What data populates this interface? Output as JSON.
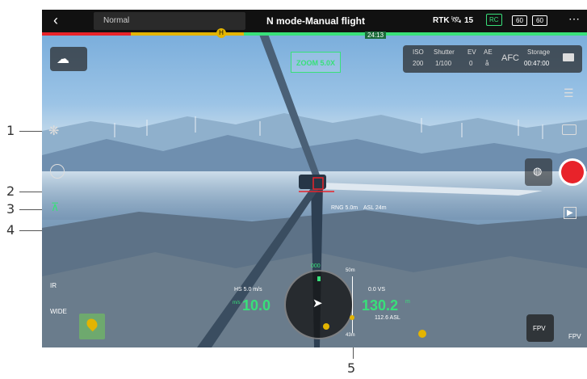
{
  "callouts": [
    "1",
    "2",
    "3",
    "4",
    "5"
  ],
  "topbar": {
    "back_icon": "chevron-left-icon",
    "mode_text": "Normal",
    "title": "N mode-Manual flight",
    "rtk_label": "RTK",
    "satellite_count": "15",
    "rc_badge": "RC",
    "battery_1": "60",
    "battery_2": "60",
    "more_icon": "more-horizontal-icon",
    "timer": "24:13"
  },
  "camera_params": {
    "iso_label": "ISO",
    "iso_value": "200",
    "shutter_label": "Shutter",
    "shutter_value": "1/100",
    "ev_label": "EV",
    "ev_value": "0",
    "ae_label": "AE",
    "ae_value": "å",
    "focus_mode": "AFC",
    "storage_label": "Storage",
    "storage_value": "00:47:00"
  },
  "zoom_indicator": "ZOOM 5.0X",
  "side_labels": {
    "ir": "IR",
    "wide": "WIDE"
  },
  "telemetry": {
    "distance_label": "RNG 5.0m",
    "asl_label": "ASL 24m",
    "hs_label": "HS 5.0 m/s",
    "vs_label": "0.0 VS",
    "speed_value": "10.0",
    "speed_unit": "m/s",
    "altitude_value": "130.2",
    "altitude_unit": "m",
    "asl_reading": "112.6 ASL",
    "compass_heading": "000",
    "altitude_scale_top": "50m",
    "altitude_scale_bottom": "43m"
  },
  "buttons": {
    "fpv_label": "FPV",
    "fpv_bottom_label": "FPV"
  },
  "colors": {
    "accent_green": "#38e07a",
    "record_red": "#e8232a",
    "status_yellow": "#e3b400"
  }
}
